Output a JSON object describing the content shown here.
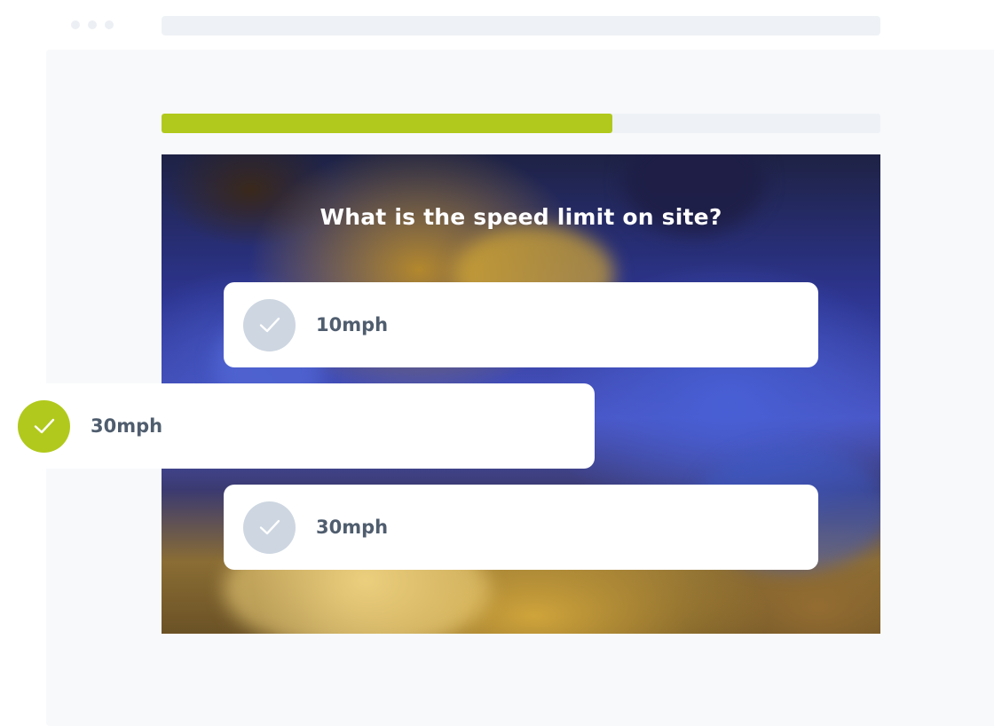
{
  "quiz": {
    "progress": 0.627,
    "question": "What is the speed limit on site?",
    "answers": [
      {
        "label": "10mph",
        "selected": false
      },
      {
        "label": "30mph",
        "selected": true
      },
      {
        "label": "30mph",
        "selected": false
      }
    ]
  },
  "colors": {
    "accent": "#b1c91c",
    "unselected_check": "#cdd6e1",
    "label_text": "#4f5d6e"
  },
  "icons": {
    "check": "checkmark-icon"
  }
}
